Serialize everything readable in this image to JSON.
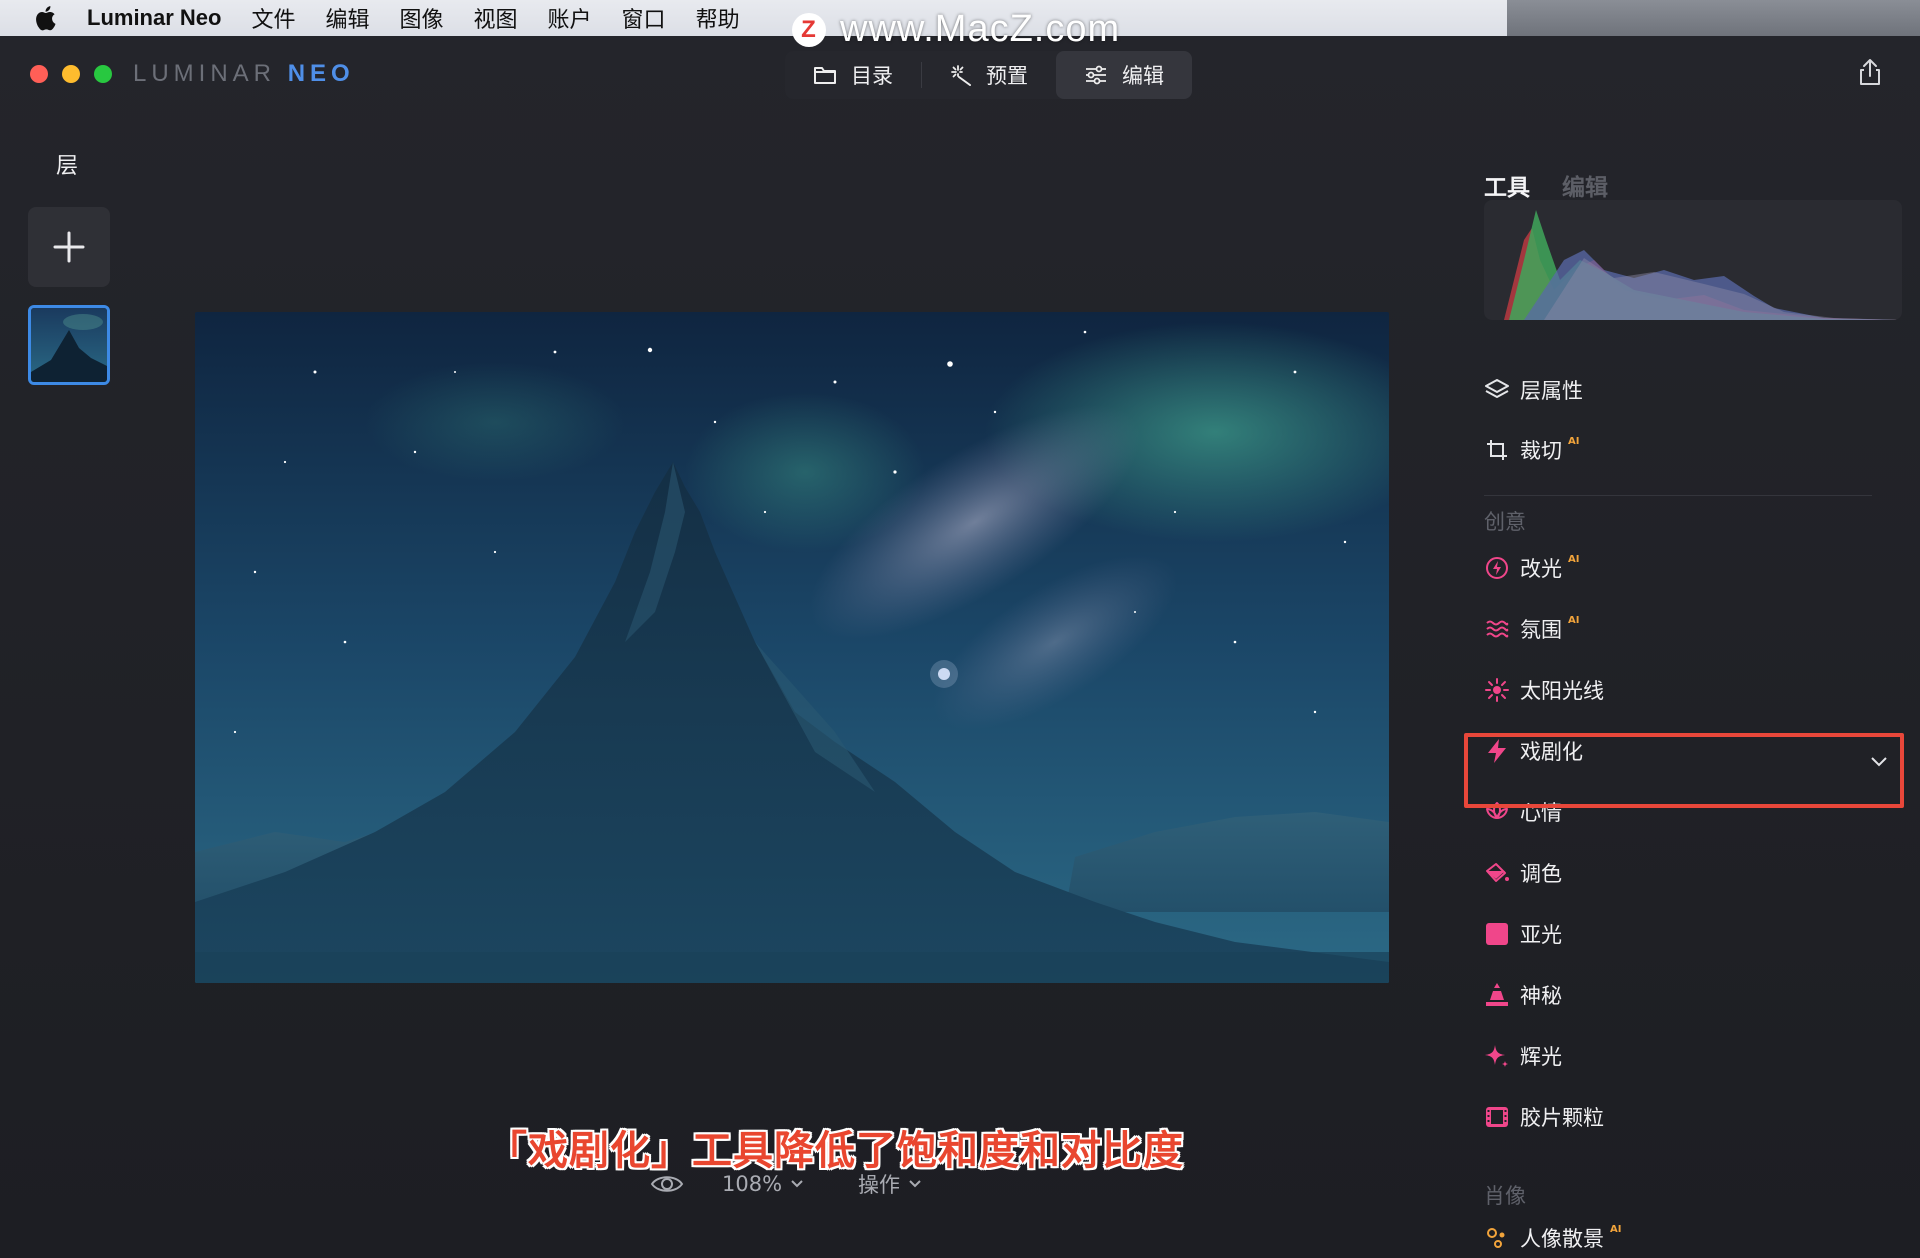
{
  "menubar": {
    "app_name": "Luminar Neo",
    "items": [
      "文件",
      "编辑",
      "图像",
      "视图",
      "账户",
      "窗口",
      "帮助"
    ]
  },
  "watermark": {
    "logo_letter": "Z",
    "text": "www.MacZ.com"
  },
  "window": {
    "brand_part1": "LUMINAR",
    "brand_part2": "NEO",
    "modes": [
      {
        "label": "目录",
        "icon": "folder-icon",
        "active": false
      },
      {
        "label": "预置",
        "icon": "magic-wand-icon",
        "active": false
      },
      {
        "label": "编辑",
        "icon": "sliders-icon",
        "active": true
      }
    ]
  },
  "layers": {
    "title": "层"
  },
  "bottombar": {
    "zoom": "108%",
    "actions": "操作"
  },
  "caption": "「戏剧化」工具降低了饱和度和对比度",
  "panel": {
    "tabs": [
      "工具",
      "编辑"
    ],
    "tools_top": [
      {
        "label": "层属性",
        "icon": "layers-icon",
        "ai": ""
      },
      {
        "label": "裁切",
        "icon": "crop-icon",
        "ai": "AI"
      }
    ],
    "section_creative": "创意",
    "tools_creative": [
      {
        "label": "改光",
        "icon": "relight-icon",
        "ai": "AI"
      },
      {
        "label": "氛围",
        "icon": "atmosphere-icon",
        "ai": "AI"
      },
      {
        "label": "太阳光线",
        "icon": "sun-rays-icon",
        "ai": ""
      },
      {
        "label": "戏剧化",
        "icon": "lightning-icon",
        "ai": ""
      },
      {
        "label": "心情",
        "icon": "lotus-icon",
        "ai": ""
      },
      {
        "label": "调色",
        "icon": "paint-bucket-icon",
        "ai": ""
      },
      {
        "label": "亚光",
        "icon": "matte-square-icon",
        "ai": ""
      },
      {
        "label": "神秘",
        "icon": "mystic-icon",
        "ai": ""
      },
      {
        "label": "辉光",
        "icon": "sparkle-icon",
        "ai": ""
      },
      {
        "label": "胶片颗粒",
        "icon": "film-icon",
        "ai": ""
      }
    ],
    "section_portrait": "肖像",
    "tool_partial": {
      "label": "人像散景",
      "ai": "AI"
    },
    "accent_color": "#f0468a",
    "highlight_color": "#e8473a"
  }
}
